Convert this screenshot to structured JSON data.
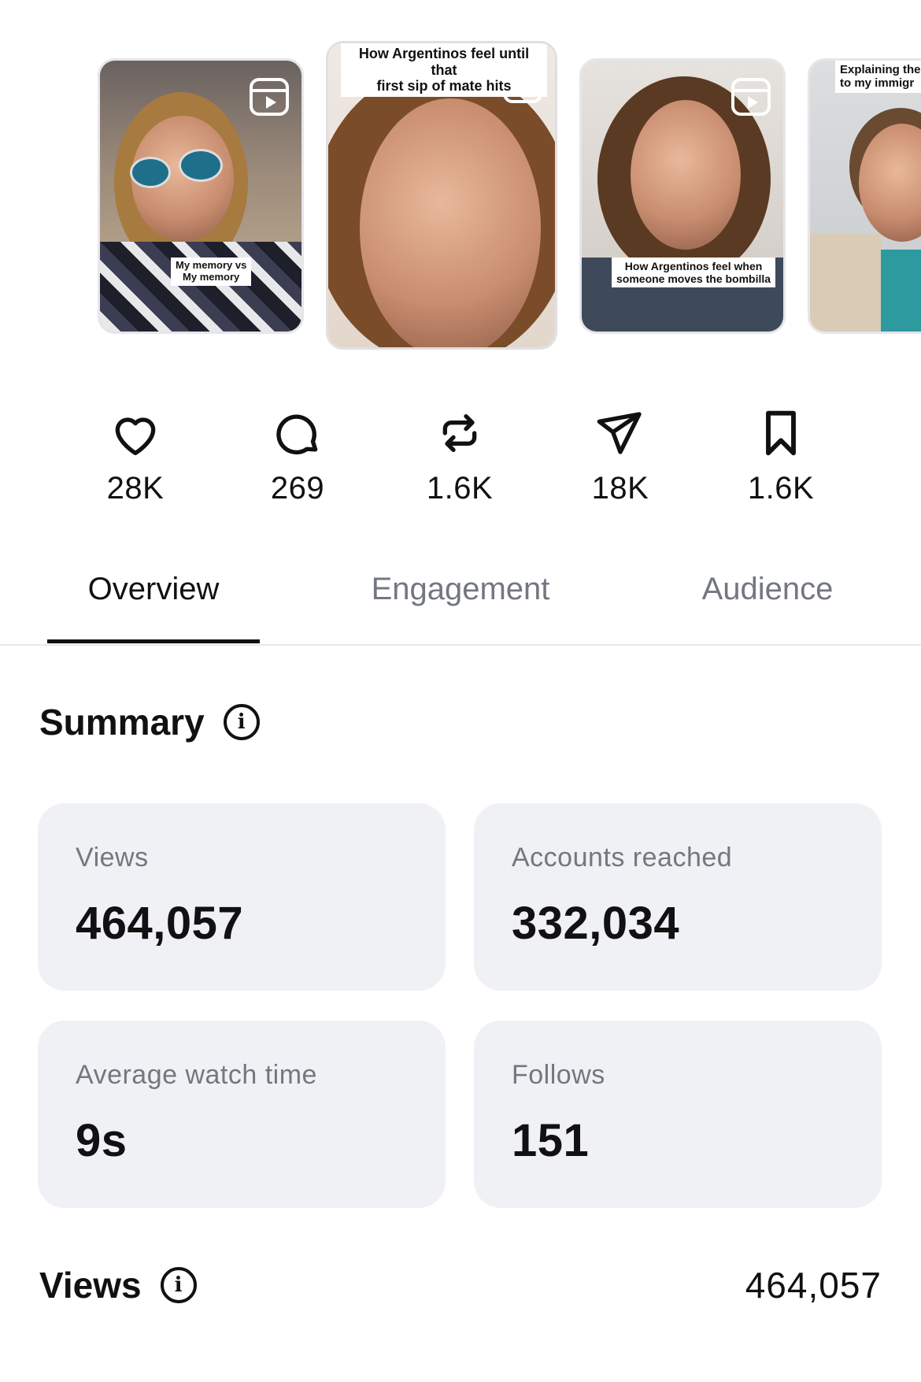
{
  "reels": [
    {
      "caption": [
        "My memory vs",
        "My memory"
      ]
    },
    {
      "caption": [
        "How Argentinos feel until that",
        "first sip of mate hits"
      ]
    },
    {
      "caption": [
        "How Argentinos feel when",
        "someone moves the bombilla"
      ]
    },
    {
      "caption": [
        "Explaining the",
        "to my immigr"
      ]
    }
  ],
  "stats": {
    "likes": "28K",
    "comments": "269",
    "reposts": "1.6K",
    "shares": "18K",
    "saves": "1.6K"
  },
  "tabs": {
    "overview": "Overview",
    "engagement": "Engagement",
    "audience": "Audience"
  },
  "summary": {
    "title": "Summary",
    "views_label": "Views",
    "views_value": "464,057",
    "reached_label": "Accounts reached",
    "reached_value": "332,034",
    "watch_label": "Average watch time",
    "watch_value": "9s",
    "follows_label": "Follows",
    "follows_value": "151"
  },
  "views_section": {
    "title": "Views",
    "total": "464,057"
  },
  "colors": {
    "card_bg": "#f0f1f5",
    "muted_text": "#737780",
    "primary_text": "#111111"
  }
}
